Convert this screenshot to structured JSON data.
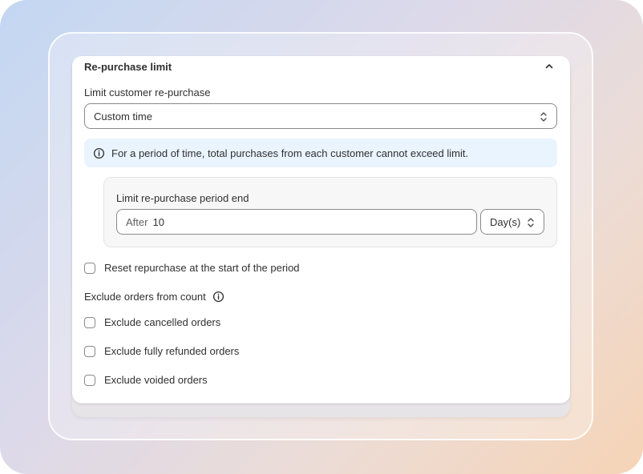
{
  "section": {
    "title": "Re-purchase limit",
    "collapse_icon": "chevron-up-icon"
  },
  "limit": {
    "label": "Limit customer re-purchase",
    "selected": "Custom time"
  },
  "banner": {
    "icon": "info-icon",
    "text": "For a period of time, total purchases from each customer cannot exceed limit.",
    "bg_color": "#eaf4ff"
  },
  "period": {
    "label": "Limit re-purchase period end",
    "prefix": "After",
    "value": "10",
    "unit": "Day(s)"
  },
  "reset": {
    "label": "Reset repurchase at the start of the period",
    "checked": false
  },
  "exclude": {
    "label": "Exclude orders from count",
    "options": [
      {
        "label": "Exclude cancelled orders",
        "checked": false
      },
      {
        "label": "Exclude fully refunded orders",
        "checked": false
      },
      {
        "label": "Exclude voided orders",
        "checked": false
      }
    ]
  }
}
